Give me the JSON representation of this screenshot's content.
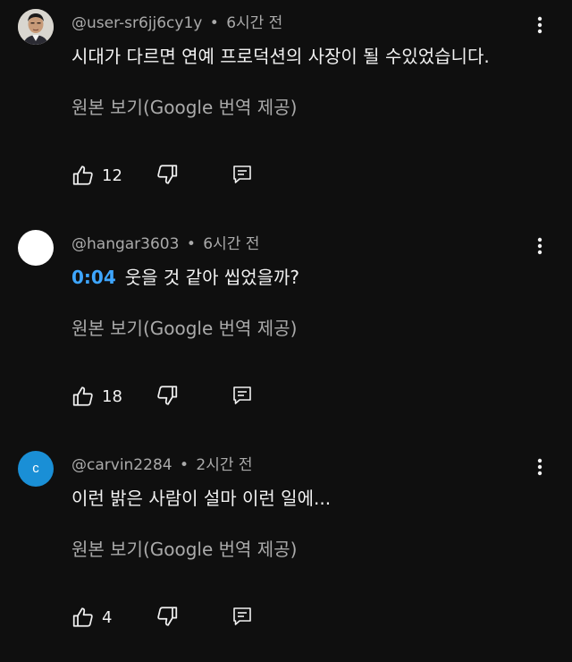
{
  "comments": [
    {
      "author": "@user-sr6jj6cy1y",
      "separator": "•",
      "time": "6시간 전",
      "timestamp_link": "",
      "text": "시대가 다르면 연예 프로덕션의 사장이 될 수있었습니다.",
      "translate_label": "원본 보기(Google 번역 제공)",
      "likes": "12",
      "avatar_style": "photo"
    },
    {
      "author": "@hangar3603",
      "separator": "•",
      "time": "6시간 전",
      "timestamp_link": "0:04",
      "text": "웃을 것 같아 씹었을까?",
      "translate_label": "원본 보기(Google 번역 제공)",
      "likes": "18",
      "avatar_style": "white"
    },
    {
      "author": "@carvin2284",
      "separator": "•",
      "time": "2시간 전",
      "timestamp_link": "",
      "text": "이런 밝은 사람이 설마 이런 일에...",
      "translate_label": "원본 보기(Google 번역 제공)",
      "likes": "4",
      "avatar_style": "blue",
      "avatar_letter": "c"
    }
  ],
  "icons": {
    "like": "thumbs-up-icon",
    "dislike": "thumbs-down-icon",
    "reply": "reply-icon",
    "more": "more-vertical-icon"
  },
  "colors": {
    "background": "#0f0f0f",
    "text": "#f1f1f1",
    "secondary_text": "#aaaaaa",
    "timestamp_link": "#3ea6ff",
    "avatar_blue": "#1a8fd6"
  }
}
